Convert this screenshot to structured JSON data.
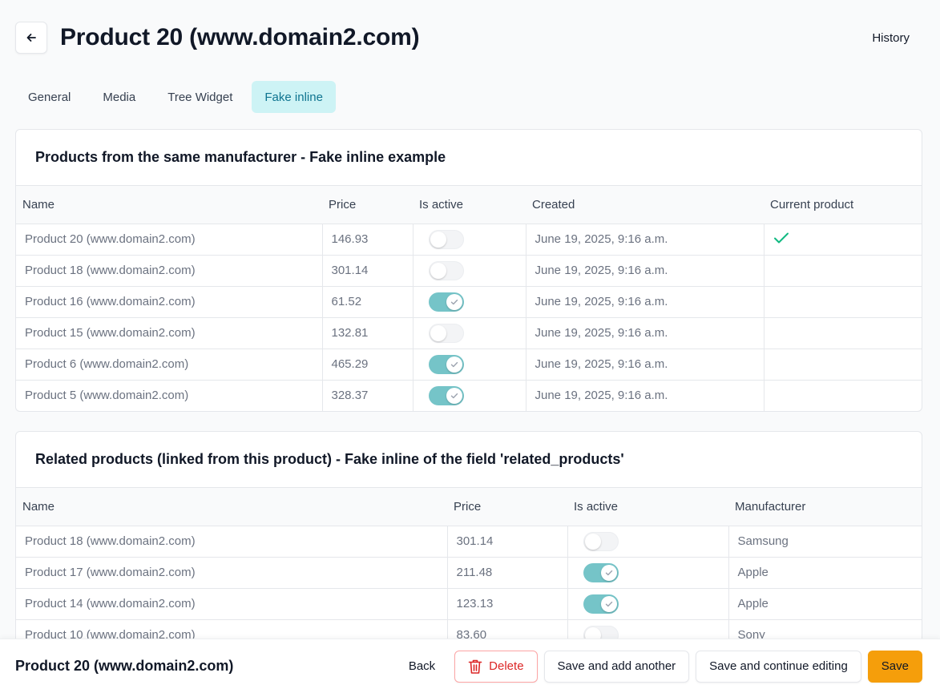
{
  "header": {
    "title": "Product 20 (www.domain2.com)",
    "history_label": "History"
  },
  "tabs": [
    {
      "label": "General",
      "active": false
    },
    {
      "label": "Media",
      "active": false
    },
    {
      "label": "Tree Widget",
      "active": false
    },
    {
      "label": "Fake inline",
      "active": true
    }
  ],
  "same_manufacturer": {
    "title": "Products from the same manufacturer - Fake inline example",
    "columns": [
      "Name",
      "Price",
      "Is active",
      "Created",
      "Current product"
    ],
    "rows": [
      {
        "name": "Product 20 (www.domain2.com)",
        "price": "146.93",
        "is_active": false,
        "created": "June 19, 2025, 9:16 a.m.",
        "current": true
      },
      {
        "name": "Product 18 (www.domain2.com)",
        "price": "301.14",
        "is_active": false,
        "created": "June 19, 2025, 9:16 a.m.",
        "current": false
      },
      {
        "name": "Product 16 (www.domain2.com)",
        "price": "61.52",
        "is_active": true,
        "created": "June 19, 2025, 9:16 a.m.",
        "current": false
      },
      {
        "name": "Product 15 (www.domain2.com)",
        "price": "132.81",
        "is_active": false,
        "created": "June 19, 2025, 9:16 a.m.",
        "current": false
      },
      {
        "name": "Product 6 (www.domain2.com)",
        "price": "465.29",
        "is_active": true,
        "created": "June 19, 2025, 9:16 a.m.",
        "current": false
      },
      {
        "name": "Product 5 (www.domain2.com)",
        "price": "328.37",
        "is_active": true,
        "created": "June 19, 2025, 9:16 a.m.",
        "current": false
      }
    ]
  },
  "related_products": {
    "title": "Related products (linked from this product) - Fake inline of the field 'related_products'",
    "columns": [
      "Name",
      "Price",
      "Is active",
      "Manufacturer"
    ],
    "rows": [
      {
        "name": "Product 18 (www.domain2.com)",
        "price": "301.14",
        "is_active": false,
        "manufacturer": "Samsung"
      },
      {
        "name": "Product 17 (www.domain2.com)",
        "price": "211.48",
        "is_active": true,
        "manufacturer": "Apple"
      },
      {
        "name": "Product 14 (www.domain2.com)",
        "price": "123.13",
        "is_active": true,
        "manufacturer": "Apple"
      },
      {
        "name": "Product 10 (www.domain2.com)",
        "price": "83.60",
        "is_active": false,
        "manufacturer": "Sony"
      }
    ]
  },
  "footer": {
    "title": "Product 20 (www.domain2.com)",
    "back_label": "Back",
    "delete_label": "Delete",
    "save_add_label": "Save and add another",
    "save_continue_label": "Save and continue editing",
    "save_label": "Save"
  },
  "colors": {
    "accent": "#75c4c8",
    "active_tab_bg": "#cdf3f5",
    "save_button": "#f59e0b",
    "delete": "#dc2626",
    "check": "#10b981"
  }
}
